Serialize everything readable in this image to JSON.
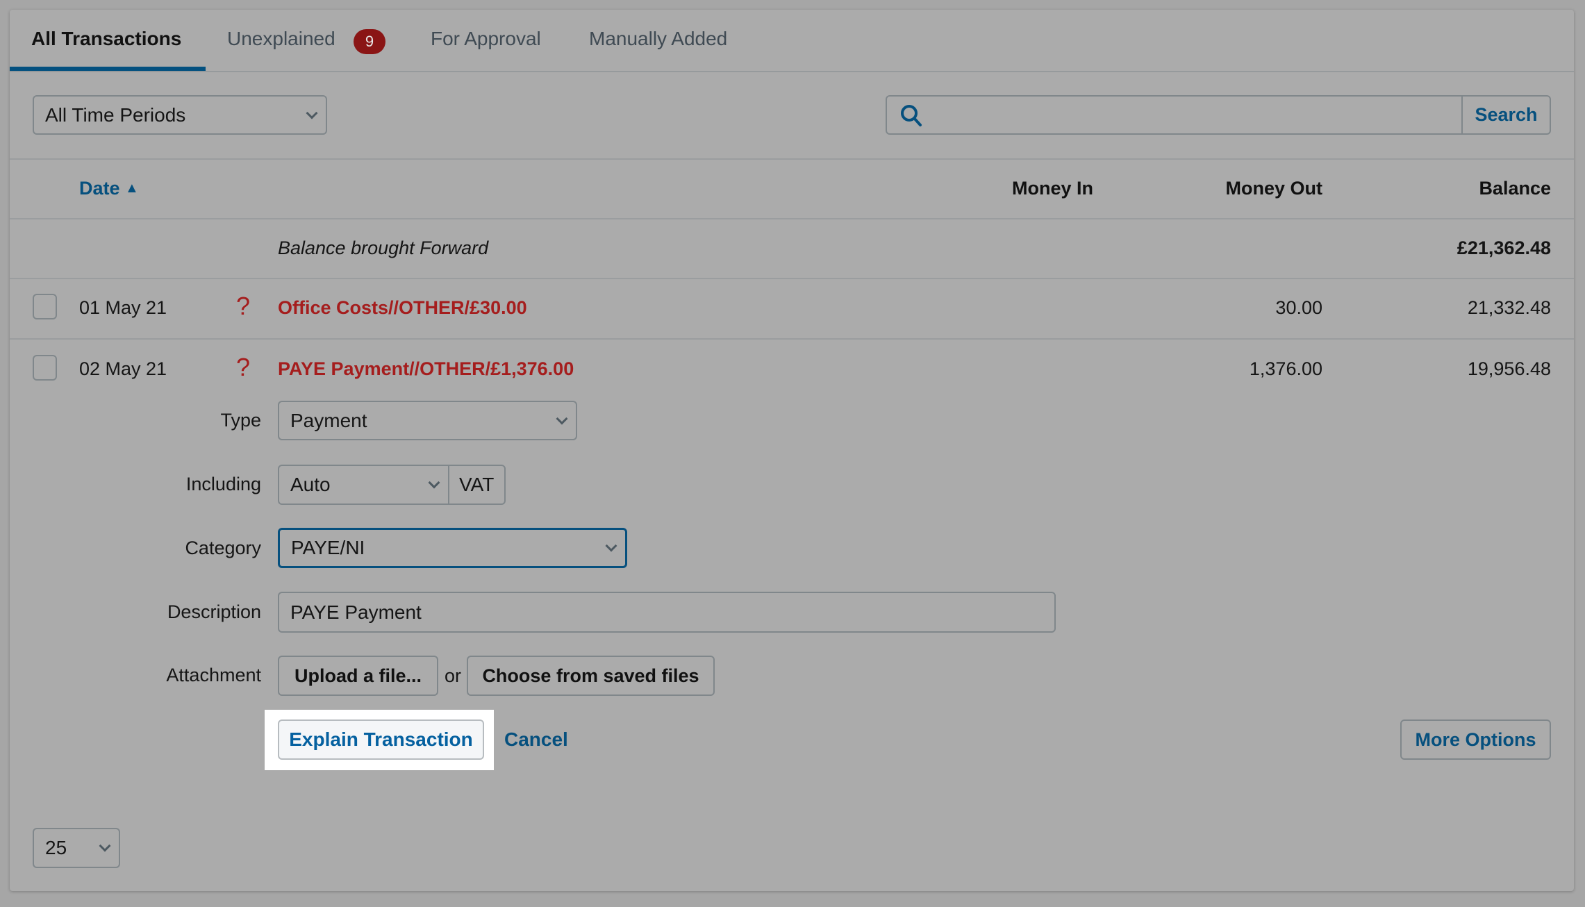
{
  "tabs": [
    {
      "label": "All Transactions",
      "active": true
    },
    {
      "label": "Unexplained",
      "badge": "9"
    },
    {
      "label": "For Approval"
    },
    {
      "label": "Manually Added"
    }
  ],
  "filters": {
    "time_period": "All Time Periods",
    "search_placeholder": "",
    "search_value": "",
    "search_button": "Search"
  },
  "table": {
    "columns": {
      "date": "Date",
      "sort_indicator": "▲",
      "money_in": "Money In",
      "money_out": "Money Out",
      "balance": "Balance"
    },
    "balance_forward": {
      "label": "Balance brought Forward",
      "balance": "£21,362.48"
    },
    "rows": [
      {
        "date": "01 May 21",
        "status_icon": "question-mark-icon",
        "description": "Office Costs//OTHER/£30.00",
        "money_in": "",
        "money_out": "30.00",
        "balance": "21,332.48"
      },
      {
        "date": "02 May 21",
        "status_icon": "question-mark-icon",
        "description": "PAYE Payment//OTHER/£1,376.00",
        "money_in": "",
        "money_out": "1,376.00",
        "balance": "19,956.48"
      }
    ]
  },
  "explain_form": {
    "type_label": "Type",
    "type_value": "Payment",
    "including_label": "Including",
    "including_value": "Auto",
    "including_suffix": "VAT",
    "category_label": "Category",
    "category_value": "PAYE/NI",
    "description_label": "Description",
    "description_value": "PAYE Payment",
    "attachment_label": "Attachment",
    "upload_button": "Upload a file...",
    "or_text": "or",
    "choose_button": "Choose from saved files",
    "explain_button": "Explain Transaction",
    "cancel_link": "Cancel",
    "more_options_button": "More Options"
  },
  "pagination": {
    "per_page": "25"
  },
  "colors": {
    "accent": "#06507e",
    "unexplained_red": "#a51d1d",
    "badge_red": "#8a1515"
  }
}
